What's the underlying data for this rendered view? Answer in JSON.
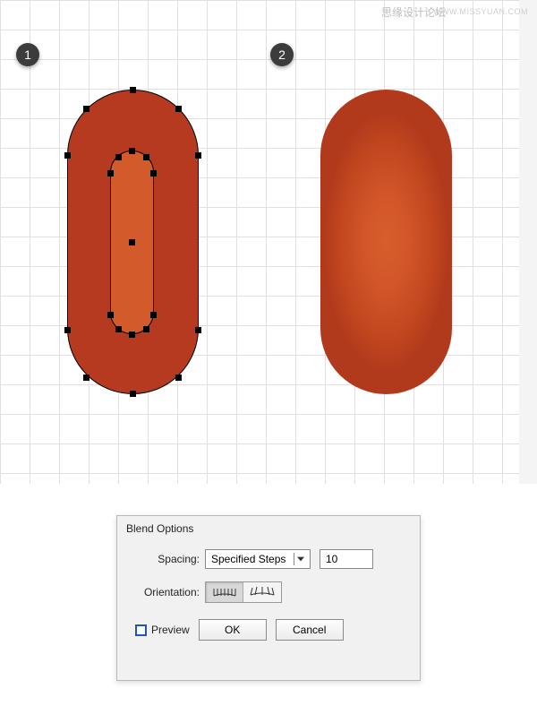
{
  "watermark": {
    "cn": "思缘设计论坛",
    "url": "WWW.MISSYUAN.COM"
  },
  "steps": {
    "one": "1",
    "two": "2"
  },
  "shapes": {
    "outer_color": "#b53a1f",
    "inner_color": "#d35a2b"
  },
  "dialog": {
    "title": "Blend Options",
    "spacing_label": "Spacing:",
    "spacing_value": "Specified Steps",
    "steps_value": "10",
    "orientation_label": "Orientation:",
    "preview_label": "Preview",
    "ok_label": "OK",
    "cancel_label": "Cancel"
  }
}
